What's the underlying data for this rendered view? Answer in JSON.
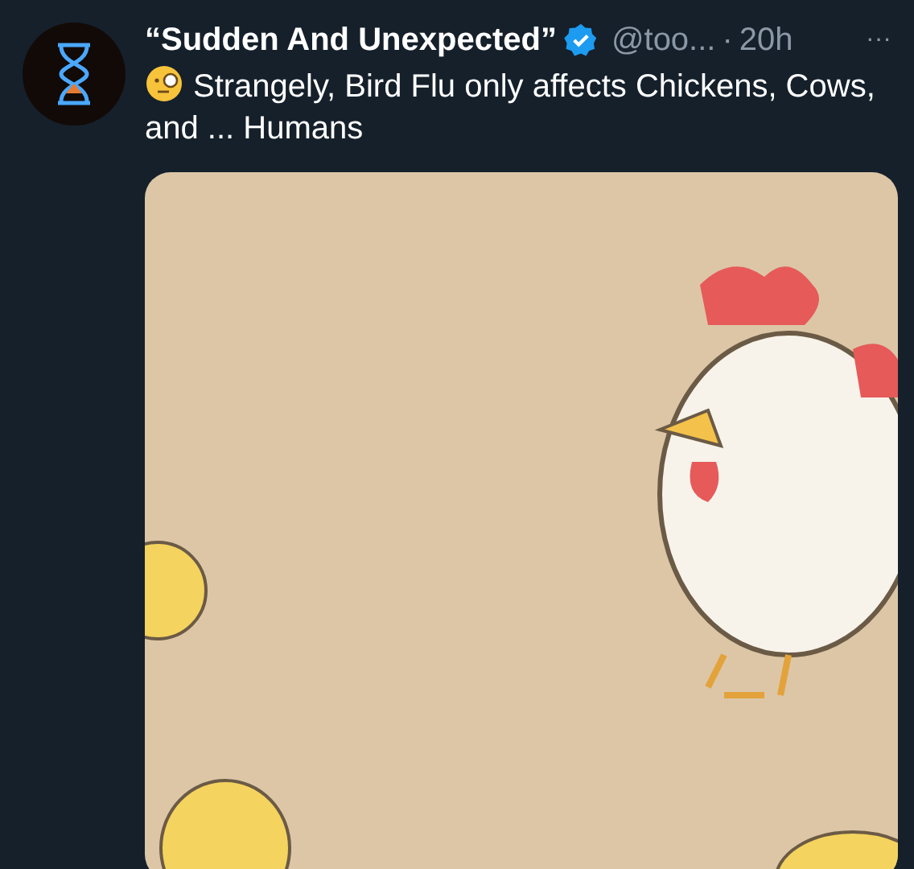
{
  "post": {
    "author": "“Sudden And Unexpected”",
    "verified": true,
    "handle": "@too...",
    "separator": "·",
    "time": "20h",
    "more": "···",
    "text": "Strangely, Bird Flu only affects Chickens, Cows, and ... Humans"
  }
}
